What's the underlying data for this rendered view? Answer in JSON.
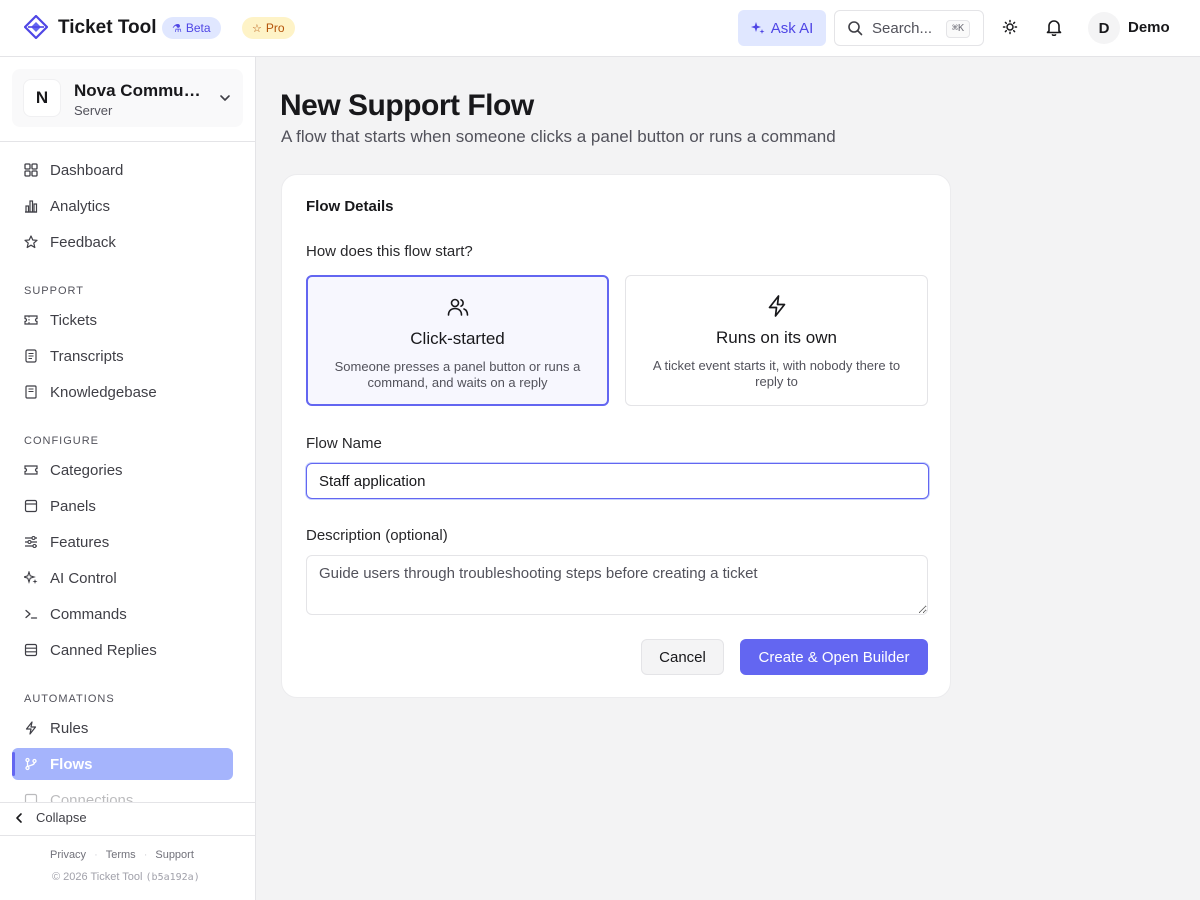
{
  "header": {
    "brand": "Ticket Tool",
    "beta_badge": "Beta",
    "pro_badge": "Pro",
    "ask_ai": "Ask AI",
    "search_placeholder": "Search...",
    "search_shortcut": "⌘K",
    "avatar_initial": "D",
    "user_name": "Demo"
  },
  "server": {
    "initial": "N",
    "name": "Nova Community",
    "type": "Server"
  },
  "sidebar": {
    "top_items": [
      "Dashboard",
      "Analytics",
      "Feedback"
    ],
    "sections": [
      {
        "label": "SUPPORT",
        "items": [
          "Tickets",
          "Transcripts",
          "Knowledgebase"
        ]
      },
      {
        "label": "CONFIGURE",
        "items": [
          "Categories",
          "Panels",
          "Features",
          "AI Control",
          "Commands",
          "Canned Replies"
        ]
      },
      {
        "label": "AUTOMATIONS",
        "items": [
          "Rules",
          "Flows",
          "Connections"
        ]
      }
    ],
    "active_item": "Flows",
    "collapse": "Collapse",
    "footer_links": [
      "Privacy",
      "Terms",
      "Support"
    ],
    "copyright": "© 2026 Ticket Tool",
    "build_hash": "(b5a192a)"
  },
  "page": {
    "title": "New Support Flow",
    "subtitle": "A flow that starts when someone clicks a panel button or runs a command"
  },
  "form": {
    "card_title": "Flow Details",
    "start_question": "How does this flow start?",
    "options": [
      {
        "title": "Click-started",
        "description": "Someone presses a panel button or runs a command, and waits on a reply",
        "icon": "users-icon",
        "selected": true
      },
      {
        "title": "Runs on its own",
        "description": "A ticket event starts it, with nobody there to reply to",
        "icon": "lightning-icon",
        "selected": false
      }
    ],
    "name_label": "Flow Name",
    "name_value": "Staff application",
    "description_label": "Description (optional)",
    "description_placeholder": "Guide users through troubleshooting steps before creating a ticket",
    "cancel_label": "Cancel",
    "create_label": "Create & Open Builder"
  },
  "colors": {
    "accent": "#6366f1",
    "active_nav": "#a5b4fc",
    "beta_badge_bg": "#e0e7ff",
    "pro_badge_bg": "#fef3c7"
  }
}
